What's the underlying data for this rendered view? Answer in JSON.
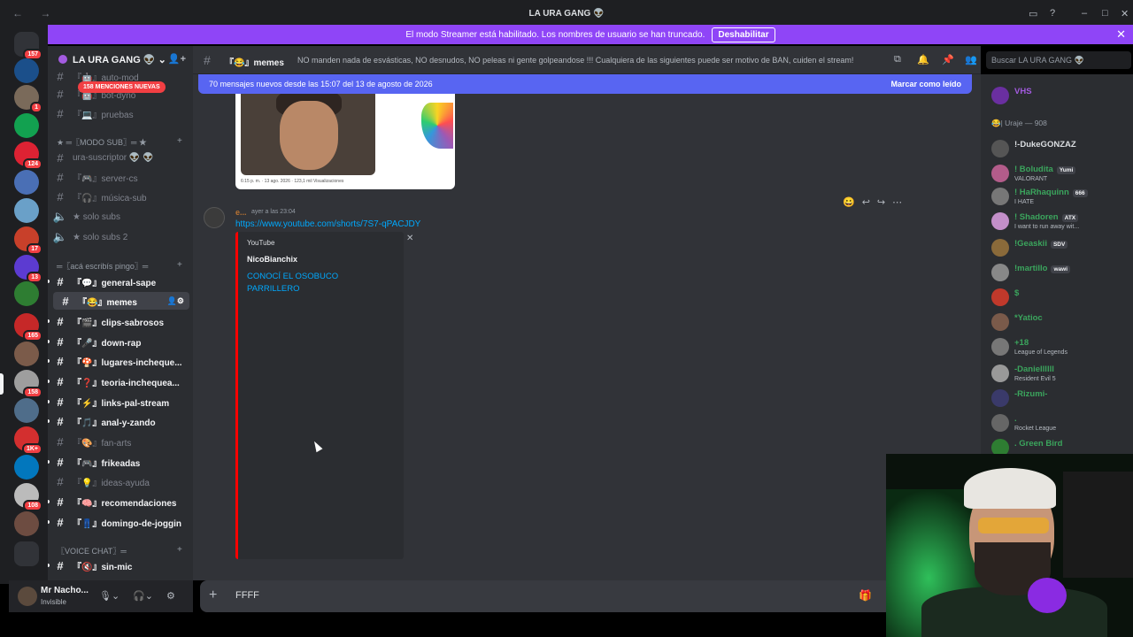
{
  "titlebar": {
    "title": "LA URA GANG 👽"
  },
  "banner": {
    "text": "El modo Streamer está habilitado. Los nombres de usuario se han truncado.",
    "button": "Deshabilitar"
  },
  "guilds": {
    "home_badge": "157",
    "badges": [
      "1",
      "124",
      "17",
      "13",
      "165",
      "158",
      "1K+",
      "108"
    ],
    "mentions": "158 MENCIONES NUEVAS"
  },
  "server": {
    "name": "LA URA GANG 👽"
  },
  "channels": {
    "top": [
      {
        "label": "『🤖』auto-mod"
      },
      {
        "label": "『🤖』bot-dyno"
      },
      {
        "label": "『💻』pruebas"
      }
    ],
    "cat_sub": "★ ═〖MODO SUB〗═ ★",
    "sub": [
      {
        "label": "ura-suscriptor 👽 👽"
      },
      {
        "label": "『🎮』server-cs"
      },
      {
        "label": "『🎧』música-sub"
      },
      {
        "label": "★ solo subs"
      },
      {
        "label": "★ solo subs 2"
      }
    ],
    "cat_main": "═〖acá escribís pingo〗═",
    "main": [
      {
        "label": "『💬』general-sape"
      },
      {
        "label": "『😂』memes"
      },
      {
        "label": "『🎬』clips-sabrosos"
      },
      {
        "label": "『🎤』down-rap"
      },
      {
        "label": "『🍄』lugares-incheque..."
      },
      {
        "label": "『❓』teoria-inchequea..."
      },
      {
        "label": "『⚡』links-pal-stream"
      },
      {
        "label": "『🎵』anal-y-zando"
      },
      {
        "label": "『🎨』fan-arts"
      },
      {
        "label": "『🎮』frikeadas"
      },
      {
        "label": "『💡』ideas-ayuda"
      },
      {
        "label": "『🧠』recomendaciones"
      },
      {
        "label": "『👖』domingo-de-joggin"
      }
    ],
    "cat_voice": "〖VOICE CHAT〗═",
    "voice": [
      {
        "label": "『🔇』sin-mic"
      }
    ]
  },
  "user": {
    "name": "Mr Nacho...",
    "status": "Invisible"
  },
  "header": {
    "channel": "『😂』memes",
    "topic": "NO manden nada de esvásticas, NO desnudos, NO peleas ni gente golpeandose !!! Cualquiera de las siguientes puede ser motivo de BAN, cuiden el stream!",
    "search_placeholder": "Buscar LA URA GANG 👽"
  },
  "chat": {
    "new_messages": "70 mensajes nuevos desde las 15:07 del 13 de agosto de 2026",
    "mark_read": "Marcar como leído",
    "image_meta": "6:15 p. m. · 13 ago. 2026 · 123,1 mil Visualizaciones",
    "author": "e...",
    "time": "ayer a las 23:04",
    "link": "https://www.youtube.com/shorts/7S7-qPACJDY",
    "embed": {
      "provider": "YouTube",
      "author": "NicoBianchix",
      "title": "CONOCÍ EL OSOBUCO PARRILLERO"
    }
  },
  "composer": {
    "text": "FFFF"
  },
  "members": {
    "top_item": "VHS",
    "category": "😂| Uraje — 908",
    "list": [
      {
        "name": "!-DukeGONZAZ",
        "activity": "",
        "color": "#dbdee1"
      },
      {
        "name": "! Boludita",
        "tag": "Yumi",
        "activity": "VALORANT",
        "color": "#3ba55d"
      },
      {
        "name": "! HaRhaquinn",
        "tag": "666",
        "activity": "I HATE",
        "color": "#3ba55d"
      },
      {
        "name": "! Shadoren",
        "tag": "ATX",
        "activity": "I want to run away wit...",
        "color": "#3ba55d"
      },
      {
        "name": "!Geaskii",
        "tag": "SDV",
        "activity": "",
        "color": "#3ba55d"
      },
      {
        "name": "!martillo",
        "tag": "wawi",
        "activity": "",
        "color": "#3ba55d"
      },
      {
        "name": "$",
        "activity": "",
        "color": "#3ba55d"
      },
      {
        "name": "*Yatioc",
        "activity": "",
        "color": "#3ba55d"
      },
      {
        "name": "+18",
        "activity": "League of Legends",
        "color": "#3ba55d"
      },
      {
        "name": "-Daniellllll",
        "activity": "Resident Evil 5",
        "color": "#3ba55d"
      },
      {
        "name": "-Rizumi-",
        "activity": "",
        "color": "#3ba55d"
      },
      {
        "name": ".",
        "activity": "Rocket League",
        "color": "#3ba55d"
      },
      {
        "name": ". Green Bird",
        "activity": "",
        "color": "#3ba55d"
      }
    ]
  }
}
